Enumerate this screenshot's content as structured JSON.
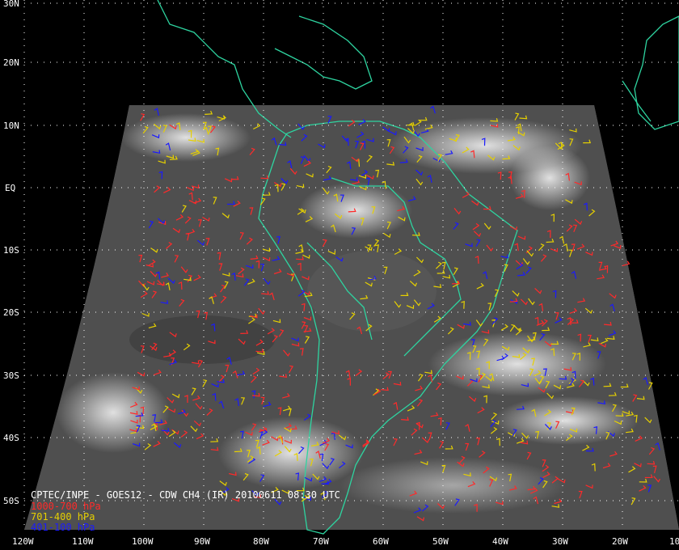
{
  "title": "CPTEC/INPE - GOES12 - CDW CH4 (IR) 20100611 08:30 UTC",
  "legend": [
    {
      "label": "1000-700 hPa",
      "color": "#ff2a2a"
    },
    {
      "label": "701-400 hPa",
      "color": "#e6d000"
    },
    {
      "label": "401-100 hPa",
      "color": "#1a1aff"
    }
  ],
  "lat_labels": [
    "30N",
    "20N",
    "10N",
    "EQ",
    "10S",
    "20S",
    "30S",
    "40S",
    "50S"
  ],
  "lon_labels": [
    "120W",
    "110W",
    "100W",
    "90W",
    "80W",
    "70W",
    "60W",
    "50W",
    "40W",
    "30W",
    "20W",
    "10"
  ],
  "colors": {
    "background": "#000000",
    "coastline": "#2ed4a0",
    "grid": "#ffffff",
    "cloud_dark": "#4a4a4a"
  }
}
